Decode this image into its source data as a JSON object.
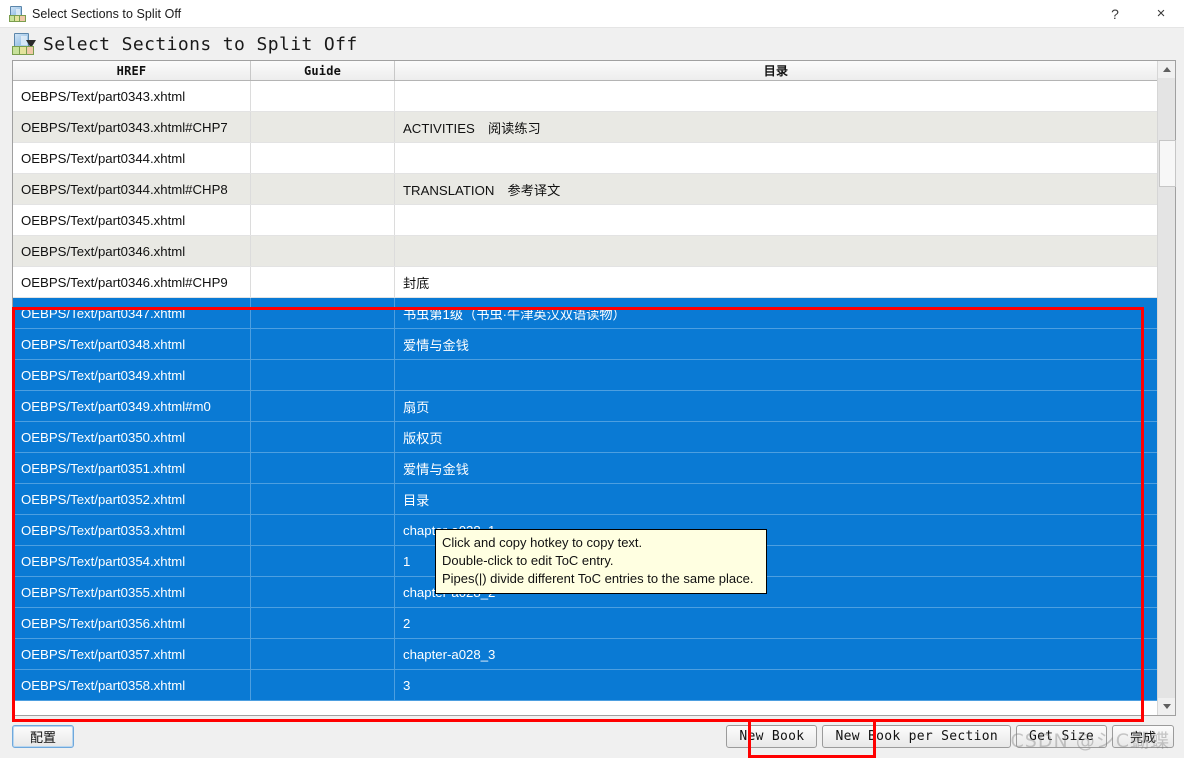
{
  "titlebar": {
    "title": "Select Sections to Split Off",
    "icon": "split-sections-icon",
    "help_label": "?",
    "close_label": "×"
  },
  "dialog": {
    "heading": "Select Sections to Split Off",
    "heading_icon": "split-sections-icon"
  },
  "table": {
    "columns": [
      "HREF",
      "Guide",
      "目录"
    ],
    "rows": [
      {
        "href": "OEBPS/Text/part0343.xhtml",
        "guide": "",
        "toc": "",
        "selected": false
      },
      {
        "href": "OEBPS/Text/part0343.xhtml#CHP7",
        "guide": "",
        "toc": "ACTIVITIES　阅读练习",
        "selected": false
      },
      {
        "href": "OEBPS/Text/part0344.xhtml",
        "guide": "",
        "toc": "",
        "selected": false
      },
      {
        "href": "OEBPS/Text/part0344.xhtml#CHP8",
        "guide": "",
        "toc": "TRANSLATION　参考译文",
        "selected": false
      },
      {
        "href": "OEBPS/Text/part0345.xhtml",
        "guide": "",
        "toc": "",
        "selected": false
      },
      {
        "href": "OEBPS/Text/part0346.xhtml",
        "guide": "",
        "toc": "",
        "selected": false
      },
      {
        "href": "OEBPS/Text/part0346.xhtml#CHP9",
        "guide": "",
        "toc": "封底",
        "selected": false
      },
      {
        "href": "OEBPS/Text/part0347.xhtml",
        "guide": "",
        "toc": "书虫第1级（书虫·牛津英汉双语读物）",
        "selected": true
      },
      {
        "href": "OEBPS/Text/part0348.xhtml",
        "guide": "",
        "toc": "爱情与金钱",
        "selected": true
      },
      {
        "href": "OEBPS/Text/part0349.xhtml",
        "guide": "",
        "toc": "",
        "selected": true
      },
      {
        "href": "OEBPS/Text/part0349.xhtml#m0",
        "guide": "",
        "toc": "扇页",
        "selected": true
      },
      {
        "href": "OEBPS/Text/part0350.xhtml",
        "guide": "",
        "toc": "版权页",
        "selected": true
      },
      {
        "href": "OEBPS/Text/part0351.xhtml",
        "guide": "",
        "toc": "爱情与金钱",
        "selected": true
      },
      {
        "href": "OEBPS/Text/part0352.xhtml",
        "guide": "",
        "toc": "目录",
        "selected": true
      },
      {
        "href": "OEBPS/Text/part0353.xhtml",
        "guide": "",
        "toc": "chapter-a028_1",
        "selected": true
      },
      {
        "href": "OEBPS/Text/part0354.xhtml",
        "guide": "",
        "toc": "1",
        "selected": true
      },
      {
        "href": "OEBPS/Text/part0355.xhtml",
        "guide": "",
        "toc": "chapter-a028_2",
        "selected": true
      },
      {
        "href": "OEBPS/Text/part0356.xhtml",
        "guide": "",
        "toc": "2",
        "selected": true
      },
      {
        "href": "OEBPS/Text/part0357.xhtml",
        "guide": "",
        "toc": "chapter-a028_3",
        "selected": true
      },
      {
        "href": "OEBPS/Text/part0358.xhtml",
        "guide": "",
        "toc": "3",
        "selected": true
      }
    ]
  },
  "tooltip": {
    "line1": "Click and copy hotkey to copy text.",
    "line2": "Double-click to edit ToC entry.",
    "line3": "Pipes(|) divide different ToC entries to the same place."
  },
  "buttons": {
    "config": "配置",
    "new_book": "New Book",
    "new_book_per_section": "New Book per Section",
    "get_size": "Get Size",
    "done": "完成"
  },
  "watermark": "CSDN @シC蝴蝶",
  "colors": {
    "selection_blue": "#0a7ad4",
    "annotation_red": "#ff0000",
    "tooltip_bg": "#ffffe1",
    "row_alt": "#e9e9e4",
    "window_bg": "#f0f0f0"
  }
}
